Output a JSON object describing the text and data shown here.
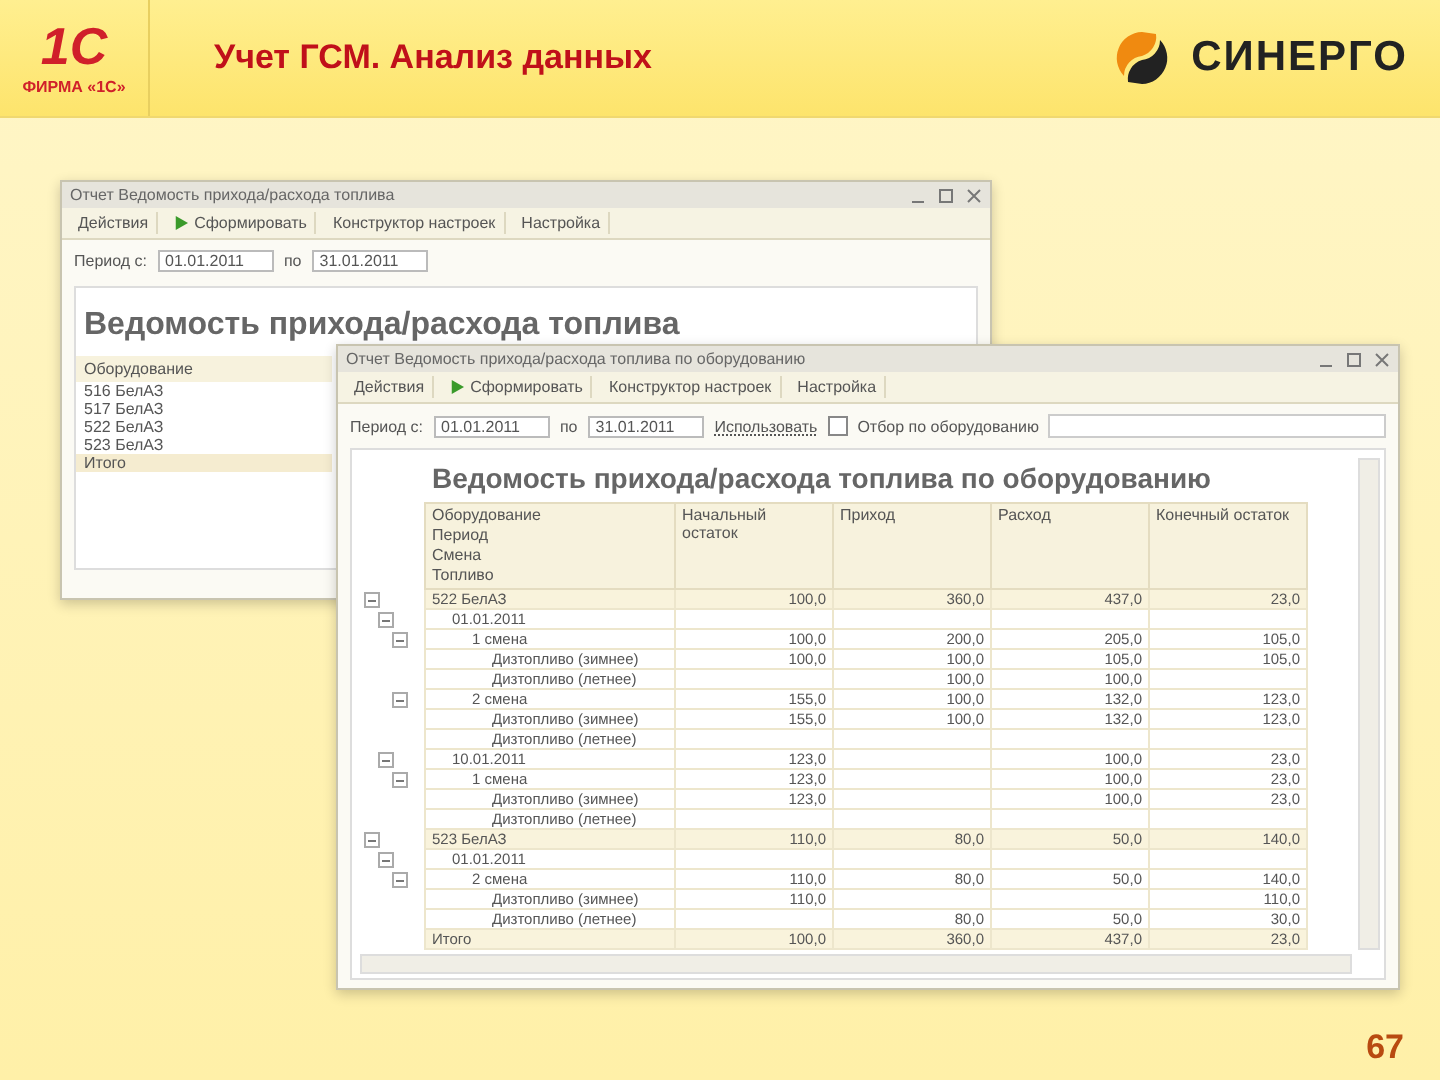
{
  "slide": {
    "logo": {
      "mark": "1С",
      "caption": "ФИРМА «1С»"
    },
    "title": "Учет ГСМ. Анализ данных",
    "brand": "СИНЕРГО",
    "page_number": "67"
  },
  "back_window": {
    "title": "Отчет  Ведомость прихода/расхода топлива",
    "toolbar": [
      "Действия",
      "Сформировать",
      "Конструктор настроек",
      "Настройка"
    ],
    "period": {
      "label_from": "Период с:",
      "from": "01.01.2011",
      "label_to": "по",
      "to": "31.01.2011"
    },
    "report_title": "Ведомость прихода/расхода топлива",
    "column": "Оборудование",
    "rows": [
      {
        "name": "516 БелАЗ",
        "total": false
      },
      {
        "name": "517 БелАЗ",
        "total": false
      },
      {
        "name": "522 БелАЗ",
        "total": false
      },
      {
        "name": "523 БелАЗ",
        "total": false
      },
      {
        "name": "Итого",
        "total": true
      }
    ]
  },
  "front_window": {
    "title": "Отчет  Ведомость прихода/расхода топлива по оборудованию",
    "toolbar": [
      "Действия",
      "Сформировать",
      "Конструктор настроек",
      "Настройка"
    ],
    "period": {
      "label_from": "Период с:",
      "from": "01.01.2011",
      "label_to": "по",
      "to": "31.01.2011"
    },
    "filter": {
      "use_label": "Использовать",
      "checked": false,
      "label": "Отбор по оборудованию"
    },
    "report_title": "Ведомость прихода/расхода топлива по оборудованию",
    "group_headers": [
      "Оборудование",
      "Период",
      "Смена",
      "Топливо"
    ],
    "columns": [
      "Начальный остаток",
      "Приход",
      "Расход",
      "Конечный остаток"
    ],
    "rows": [
      {
        "name": "522 БелАЗ",
        "values": {
          "opening": "100,0",
          "income": "360,0",
          "expense": "437,0",
          "closing": "23,0"
        },
        "expanded": true,
        "children": [
          {
            "name": "01.01.2011",
            "expanded": true,
            "children": [
              {
                "name": "1 смена",
                "values": {
                  "opening": "100,0",
                  "income": "200,0",
                  "expense": "205,0",
                  "closing": "105,0"
                },
                "expanded": true,
                "children": [
                  {
                    "name": "Дизтопливо (зимнее)",
                    "values": {
                      "opening": "100,0",
                      "income": "100,0",
                      "expense": "105,0",
                      "closing": "105,0"
                    }
                  },
                  {
                    "name": "Дизтопливо (летнее)",
                    "values": {
                      "income": "100,0",
                      "expense": "100,0"
                    }
                  }
                ]
              },
              {
                "name": "2 смена",
                "values": {
                  "opening": "155,0",
                  "income": "100,0",
                  "expense": "132,0",
                  "closing": "123,0"
                },
                "expanded": true,
                "children": [
                  {
                    "name": "Дизтопливо (зимнее)",
                    "values": {
                      "opening": "155,0",
                      "income": "100,0",
                      "expense": "132,0",
                      "closing": "123,0"
                    }
                  },
                  {
                    "name": "Дизтопливо (летнее)"
                  }
                ]
              }
            ]
          },
          {
            "name": "10.01.2011",
            "values": {
              "opening": "123,0",
              "expense": "100,0",
              "closing": "23,0"
            },
            "expanded": true,
            "children": [
              {
                "name": "1 смена",
                "values": {
                  "opening": "123,0",
                  "expense": "100,0",
                  "closing": "23,0"
                },
                "expanded": true,
                "children": [
                  {
                    "name": "Дизтопливо (зимнее)",
                    "values": {
                      "opening": "123,0",
                      "expense": "100,0",
                      "closing": "23,0"
                    }
                  },
                  {
                    "name": "Дизтопливо (летнее)"
                  }
                ]
              }
            ]
          }
        ]
      },
      {
        "name": "523 БелАЗ",
        "values": {
          "opening": "110,0",
          "income": "80,0",
          "expense": "50,0",
          "closing": "140,0"
        },
        "expanded": true,
        "children": [
          {
            "name": "01.01.2011",
            "expanded": true,
            "children": [
              {
                "name": "2 смена",
                "values": {
                  "opening": "110,0",
                  "income": "80,0",
                  "expense": "50,0",
                  "closing": "140,0"
                },
                "expanded": true,
                "children": [
                  {
                    "name": "Дизтопливо (зимнее)",
                    "values": {
                      "opening": "110,0",
                      "closing": "110,0"
                    }
                  },
                  {
                    "name": "Дизтопливо (летнее)",
                    "values": {
                      "income": "80,0",
                      "expense": "50,0",
                      "closing": "30,0"
                    }
                  }
                ]
              }
            ]
          }
        ]
      }
    ],
    "total": {
      "name": "Итого",
      "values": {
        "opening": "100,0",
        "income": "360,0",
        "expense": "437,0",
        "closing": "23,0"
      }
    }
  }
}
